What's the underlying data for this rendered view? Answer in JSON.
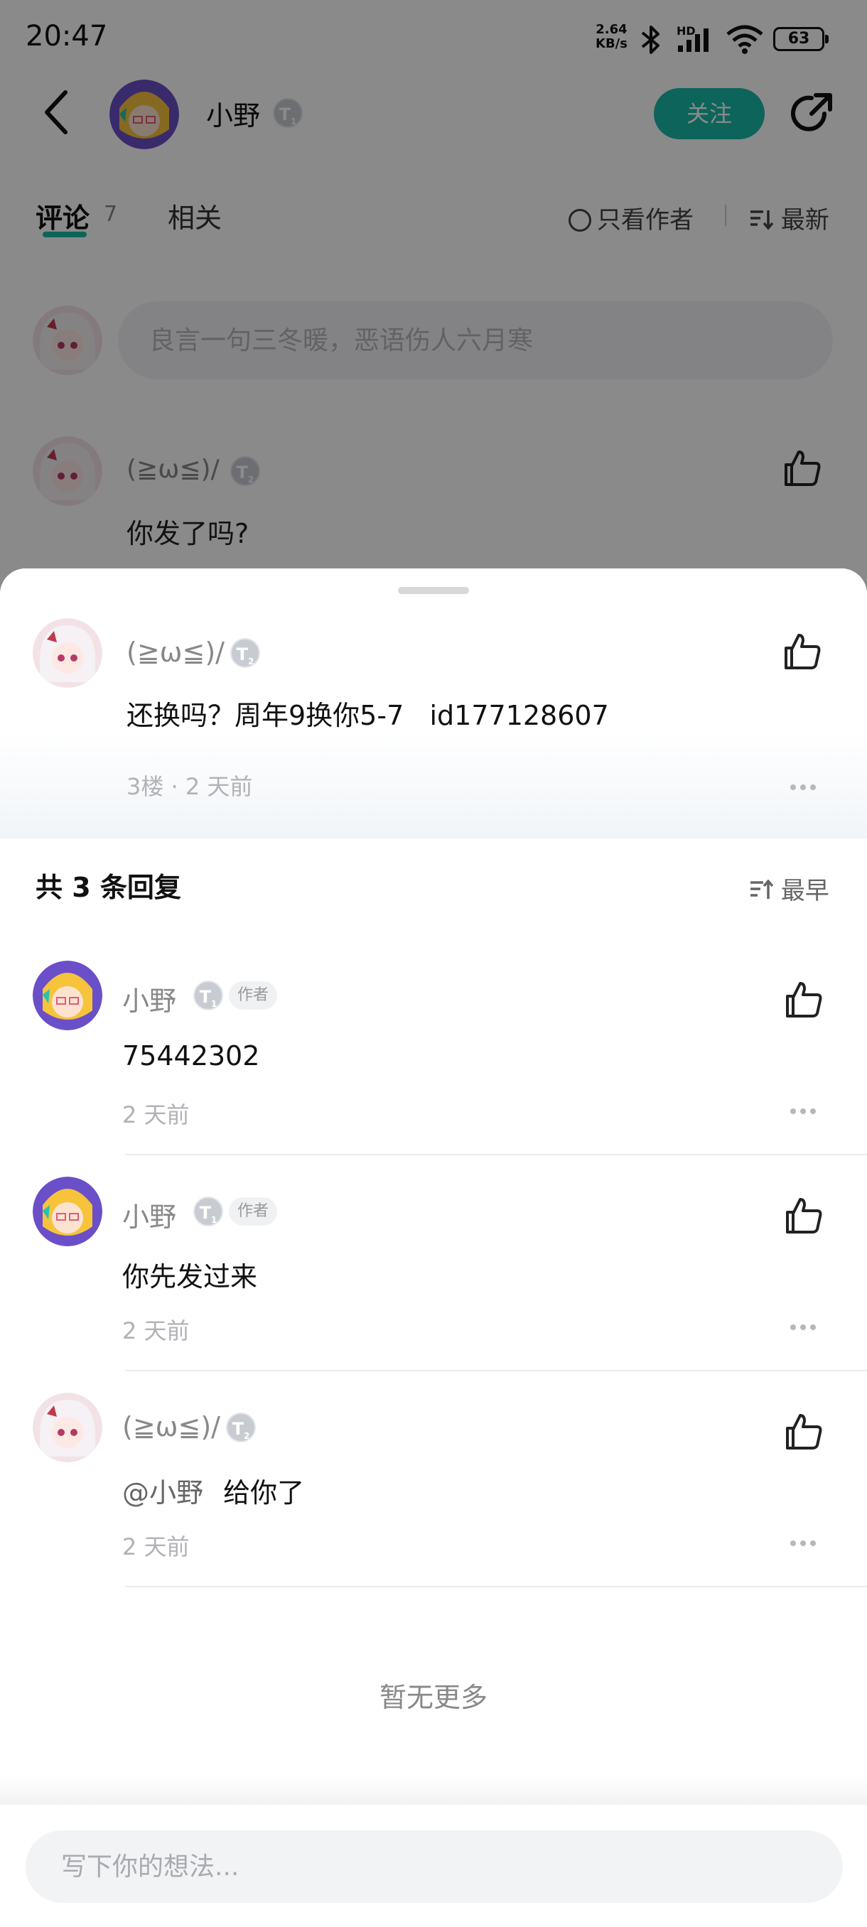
{
  "status_bar": {
    "time": "20:47",
    "net_speed_value": "2.64",
    "net_speed_unit": "KB/s",
    "signal_label": "HD",
    "battery": "63"
  },
  "header": {
    "author_name": "小野",
    "author_level": "T",
    "author_level_sub": "1",
    "follow_label": "关注"
  },
  "tabs": {
    "comments_label": "评论",
    "comments_count": "7",
    "related_label": "相关",
    "author_only_label": "只看作者",
    "sort_label": "最新"
  },
  "comment_input": {
    "placeholder": "良言一句三冬暖，恶语伤人六月寒"
  },
  "background_comment": {
    "name": "(≧ω≦)/",
    "level": "T",
    "level_sub": "2",
    "text": "你发了吗?"
  },
  "sheet": {
    "main_comment": {
      "name": "(≧ω≦)/",
      "level": "T",
      "level_sub": "2",
      "text": "还换吗？周年9换你5-7   id177128607",
      "meta": "3楼 · 2 天前"
    },
    "reply_count_label": "共 3 条回复",
    "sort_label": "最早",
    "replies": [
      {
        "name": "小野",
        "level": "T",
        "level_sub": "1",
        "tag": "作者",
        "text": "75442302",
        "time": "2 天前"
      },
      {
        "name": "小野",
        "level": "T",
        "level_sub": "1",
        "tag": "作者",
        "text": "你先发过来",
        "time": "2 天前"
      },
      {
        "name": "(≧ω≦)/",
        "level": "T",
        "level_sub": "2",
        "mention": "@小野",
        "text": "给你了",
        "time": "2 天前"
      }
    ],
    "no_more_label": "暂无更多",
    "reply_input": {
      "placeholder": "写下你的想法..."
    }
  },
  "colors": {
    "accent": "#19b9a7",
    "overlay": "rgba(0,0,0,0.46)",
    "muted_text": "#888888"
  },
  "icons": [
    "back-arrow-icon",
    "share-icon",
    "like-icon",
    "more-dots-icon",
    "sort-icon",
    "bluetooth-icon",
    "signal-icon",
    "wifi-icon",
    "battery-icon"
  ]
}
